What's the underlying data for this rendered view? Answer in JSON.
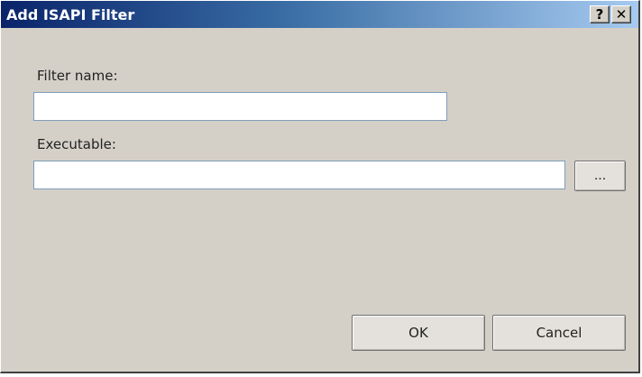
{
  "window": {
    "title": "Add ISAPI Filter",
    "help_label": "?",
    "close_label": "✕"
  },
  "form": {
    "filter_name_label": "Filter name:",
    "filter_name_value": "",
    "executable_label": "Executable:",
    "executable_value": "",
    "browse_label": "..."
  },
  "footer": {
    "ok_label": "OK",
    "cancel_label": "Cancel"
  }
}
